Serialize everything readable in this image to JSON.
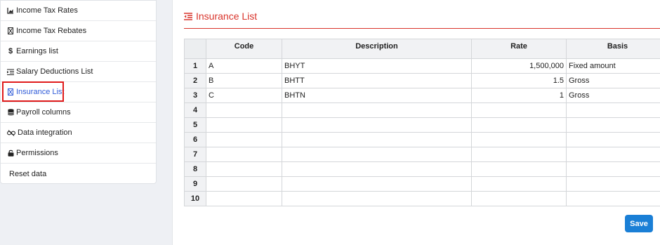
{
  "sidebar": {
    "items": [
      {
        "label": "Income Tax Rates",
        "icon": "chart-area-icon"
      },
      {
        "label": "Income Tax Rebates",
        "icon": "hourglass-box-icon"
      },
      {
        "label": "Earnings list",
        "icon": "dollar-icon"
      },
      {
        "label": "Salary Deductions List",
        "icon": "indent-list-icon"
      },
      {
        "label": "Insurance List",
        "icon": "hourglass-box-icon",
        "active": true
      },
      {
        "label": "Payroll columns",
        "icon": "database-icon"
      },
      {
        "label": "Data integration",
        "icon": "unlink-icon"
      },
      {
        "label": "Permissions",
        "icon": "lock-icon"
      },
      {
        "label": "Reset data",
        "icon": ""
      }
    ]
  },
  "main": {
    "title": "Insurance List",
    "title_icon": "outdent-list-icon",
    "accent_color": "#d9342b",
    "grid": {
      "headers": [
        "Code",
        "Description",
        "Rate",
        "Basis"
      ],
      "rows": [
        {
          "n": "1",
          "code": "A",
          "description": "BHYT",
          "rate": "1,500,000",
          "basis": "Fixed amount"
        },
        {
          "n": "2",
          "code": "B",
          "description": "BHTT",
          "rate": "1.5",
          "basis": "Gross"
        },
        {
          "n": "3",
          "code": "C",
          "description": "BHTN",
          "rate": "1",
          "basis": "Gross"
        },
        {
          "n": "4",
          "code": "",
          "description": "",
          "rate": "",
          "basis": ""
        },
        {
          "n": "5",
          "code": "",
          "description": "",
          "rate": "",
          "basis": ""
        },
        {
          "n": "6",
          "code": "",
          "description": "",
          "rate": "",
          "basis": ""
        },
        {
          "n": "7",
          "code": "",
          "description": "",
          "rate": "",
          "basis": ""
        },
        {
          "n": "8",
          "code": "",
          "description": "",
          "rate": "",
          "basis": ""
        },
        {
          "n": "9",
          "code": "",
          "description": "",
          "rate": "",
          "basis": ""
        },
        {
          "n": "10",
          "code": "",
          "description": "",
          "rate": "",
          "basis": ""
        }
      ]
    },
    "save_label": "Save",
    "save_color": "#1a7fd6"
  }
}
